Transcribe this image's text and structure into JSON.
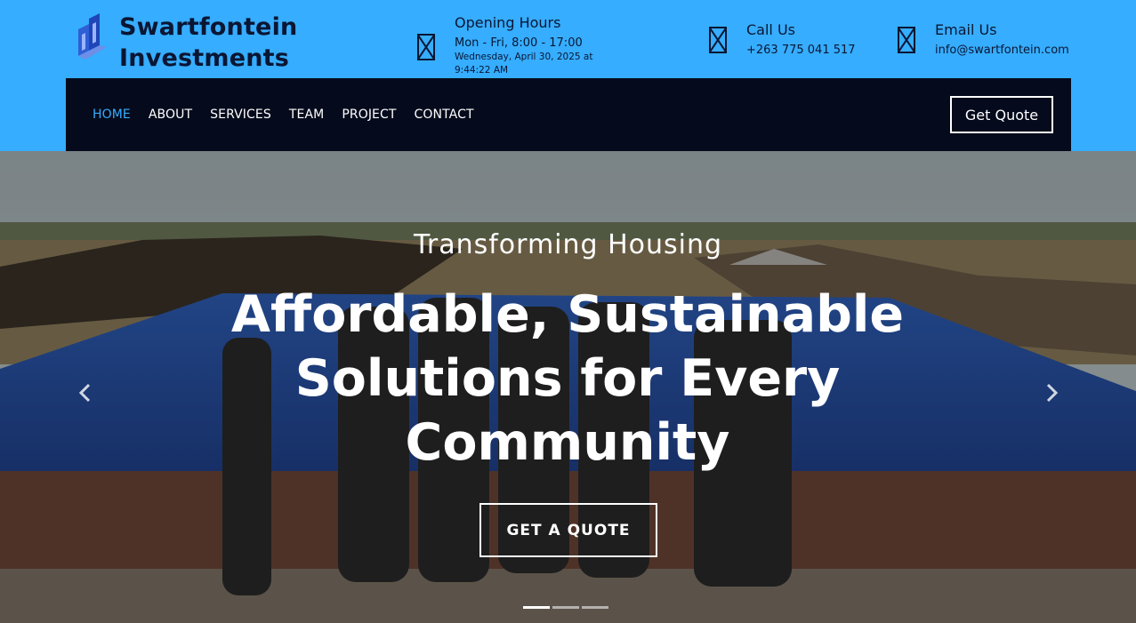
{
  "brand": {
    "name_line1": "Swartfontein",
    "name_line2": "Investments"
  },
  "header": {
    "hours": {
      "icon": "broken-image-icon",
      "title": "Opening Hours",
      "line": "Mon - Fri, 8:00 - 17:00",
      "datetime": "Wednesday, April 30, 2025 at 9:44:22 AM"
    },
    "call": {
      "icon": "broken-image-icon",
      "title": "Call Us",
      "line": "+263 775 041 517"
    },
    "email": {
      "icon": "broken-image-icon",
      "title": "Email Us",
      "line": "info@swartfontein.com"
    }
  },
  "nav": {
    "items": [
      "HOME",
      "ABOUT",
      "SERVICES",
      "TEAM",
      "PROJECT",
      "CONTACT"
    ],
    "active": "HOME",
    "quote_label": "Get Quote"
  },
  "hero": {
    "eyebrow": "Transforming Housing",
    "heading": "Affordable, Sustainable Solutions for Every Community",
    "cta_label": "GET A QUOTE",
    "prev_icon": "chevron-left-icon",
    "next_icon": "chevron-right-icon",
    "slide_count": 3,
    "active_slide": 1
  },
  "colors": {
    "header_blue": "#36adfe",
    "nav_dark": "#050b1c",
    "text_dark": "#0a1633",
    "white": "#ffffff"
  }
}
